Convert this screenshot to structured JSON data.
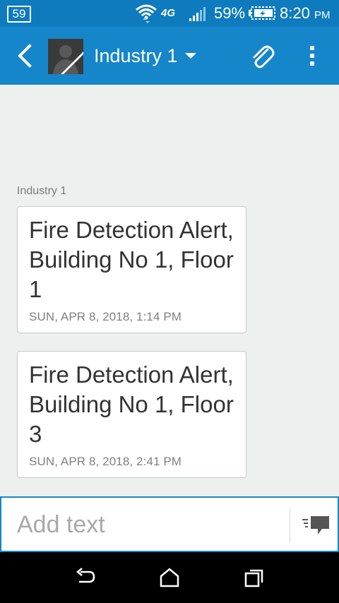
{
  "status_bar": {
    "notification_badge": "59",
    "network_type": "4G",
    "battery_percent": "59%",
    "time": "8:20",
    "time_suffix": "PM",
    "icons": [
      "wifi-icon",
      "signal-icon",
      "battery-charging-icon"
    ]
  },
  "app_bar": {
    "title": "Industry 1",
    "icons": [
      "back-arrow-icon",
      "avatar",
      "chevron-down-icon",
      "paperclip-icon",
      "more-vert-icon"
    ]
  },
  "conversation": {
    "sender": "Industry 1",
    "messages": [
      {
        "text": "Fire Detection Alert, Building No 1, Floor 1",
        "timestamp": "SUN, APR 8, 2018, 1:14 PM"
      },
      {
        "text": "Fire Detection Alert, Building No 1, Floor 3",
        "timestamp": "SUN, APR 8, 2018, 2:41 PM"
      }
    ]
  },
  "composer": {
    "placeholder": "Add text",
    "value": "",
    "send_icon": "send-message-icon"
  },
  "nav_bar": {
    "icons": [
      "back-nav-icon",
      "home-icon",
      "recents-icon"
    ]
  },
  "colors": {
    "status_bar_bg": "#0d7bbd",
    "app_bar_bg": "#1586c9",
    "content_bg": "#eef0f0",
    "nav_bar_bg": "#000000"
  }
}
